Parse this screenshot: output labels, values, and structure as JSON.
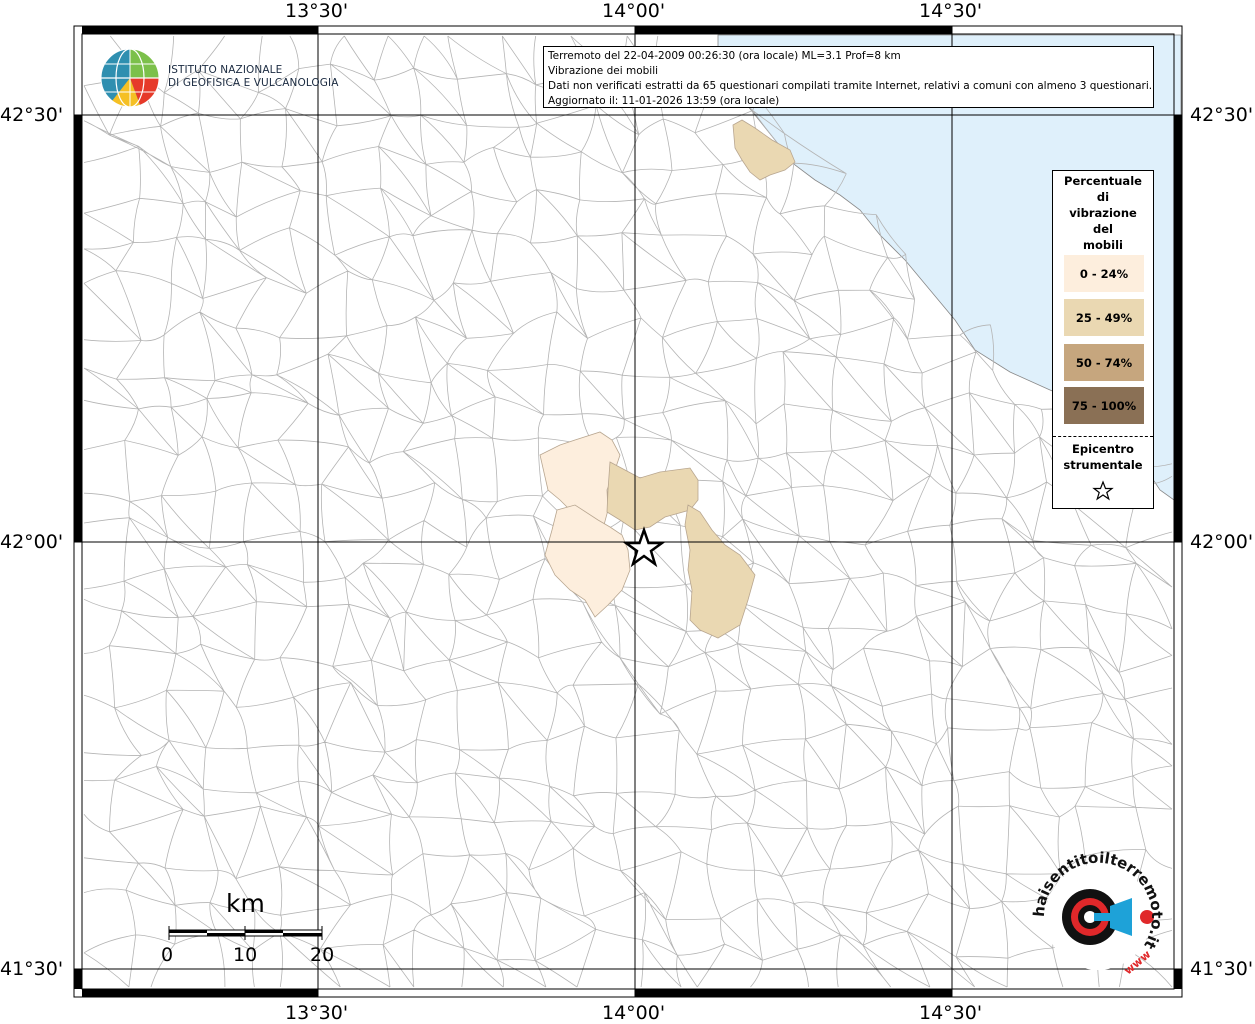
{
  "info_box": {
    "line1": "Terremoto del 22-04-2009 00:26:30 (ora locale) ML=3.1 Prof=8 km",
    "line2": "Vibrazione dei mobili",
    "line3": "Dati non verificati estratti da 65 questionari compilati tramite Internet, relativi a comuni con almeno 3 questionari.",
    "line4": "Aggiornato il: 11-01-2026 13:59 (ora locale)"
  },
  "logo": {
    "line1": "ISTITUTO NAZIONALE",
    "line2": "DI GEOFISICA E VULCANOLOGIA"
  },
  "longitude_labels": [
    "13°30'",
    "14°00'",
    "14°30'"
  ],
  "latitude_labels": [
    "42°30'",
    "42°00'",
    "41°30'"
  ],
  "legend": {
    "title": "Percentuale\ndi\nvibrazione\ndel\nmobili",
    "classes": [
      {
        "label": "0 - 24%",
        "color": "#fdeedd"
      },
      {
        "label": "25 - 49%",
        "color": "#ead8b2"
      },
      {
        "label": "50 - 74%",
        "color": "#c6a67e"
      },
      {
        "label": "75 - 100%",
        "color": "#8a7055"
      }
    ],
    "epicenter_label": "Epicentro\nstrumentale"
  },
  "scale_bar": {
    "unit": "km",
    "ticks": [
      "0",
      "10",
      "20"
    ]
  },
  "brand_logo": {
    "text": "haisentitoilterremoto.it",
    "url_text": "www"
  },
  "colors": {
    "sea": "#dff0fb",
    "boundaries": "#b4b4b4",
    "grid": "#000000"
  }
}
